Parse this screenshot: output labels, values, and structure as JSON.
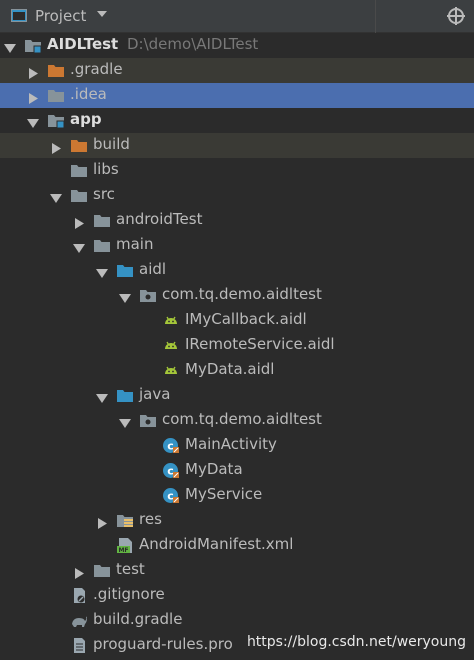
{
  "header": {
    "title": "Project"
  },
  "tree": [
    {
      "label": "AIDLTest",
      "path": "D:\\demo\\AIDLTest",
      "bold": true,
      "depth": 0,
      "arrow": "down",
      "icon": "module-folder-icon"
    },
    {
      "label": ".gradle",
      "depth": 1,
      "arrow": "right",
      "icon": "orange-folder-icon",
      "state": "hl"
    },
    {
      "label": ".idea",
      "depth": 1,
      "arrow": "right",
      "icon": "folder-icon",
      "state": "sel"
    },
    {
      "label": "app",
      "bold": true,
      "depth": 1,
      "arrow": "down",
      "icon": "module-folder-icon"
    },
    {
      "label": "build",
      "depth": 2,
      "arrow": "right",
      "icon": "orange-folder-icon",
      "state": "hl"
    },
    {
      "label": "libs",
      "depth": 2,
      "icon": "folder-icon"
    },
    {
      "label": "src",
      "depth": 2,
      "arrow": "down",
      "icon": "folder-icon"
    },
    {
      "label": "androidTest",
      "depth": 3,
      "arrow": "right",
      "icon": "folder-icon"
    },
    {
      "label": "main",
      "depth": 3,
      "arrow": "down",
      "icon": "folder-icon"
    },
    {
      "label": "aidl",
      "depth": 4,
      "arrow": "down",
      "icon": "blue-folder-icon"
    },
    {
      "label": "com.tq.demo.aidltest",
      "depth": 5,
      "arrow": "down",
      "icon": "package-icon"
    },
    {
      "label": "IMyCallback.aidl",
      "depth": 6,
      "icon": "android-icon"
    },
    {
      "label": "IRemoteService.aidl",
      "depth": 6,
      "icon": "android-icon"
    },
    {
      "label": "MyData.aidl",
      "depth": 6,
      "icon": "android-icon"
    },
    {
      "label": "java",
      "depth": 4,
      "arrow": "down",
      "icon": "blue-folder-icon"
    },
    {
      "label": "com.tq.demo.aidltest",
      "depth": 5,
      "arrow": "down",
      "icon": "package-icon"
    },
    {
      "label": "MainActivity",
      "depth": 6,
      "icon": "class-icon"
    },
    {
      "label": "MyData",
      "depth": 6,
      "icon": "class-icon"
    },
    {
      "label": "MyService",
      "depth": 6,
      "icon": "class-icon"
    },
    {
      "label": "res",
      "depth": 4,
      "arrow": "right",
      "icon": "res-folder-icon"
    },
    {
      "label": "AndroidManifest.xml",
      "depth": 4,
      "icon": "manifest-icon"
    },
    {
      "label": "test",
      "depth": 3,
      "arrow": "right",
      "icon": "folder-icon"
    },
    {
      "label": ".gitignore",
      "depth": 2,
      "icon": "gitignore-icon"
    },
    {
      "label": "build.gradle",
      "depth": 2,
      "icon": "gradle-icon"
    },
    {
      "label": "proguard-rules.pro",
      "depth": 2,
      "icon": "file-icon"
    }
  ],
  "watermark": "https://blog.csdn.net/weryoung",
  "colors": {
    "selection": "#4b6eaf",
    "highlight": "#3a3a35",
    "background": "#2b2b2b",
    "android": "#a4c639",
    "class": "#3592c4",
    "excluded": "#cc7832"
  }
}
